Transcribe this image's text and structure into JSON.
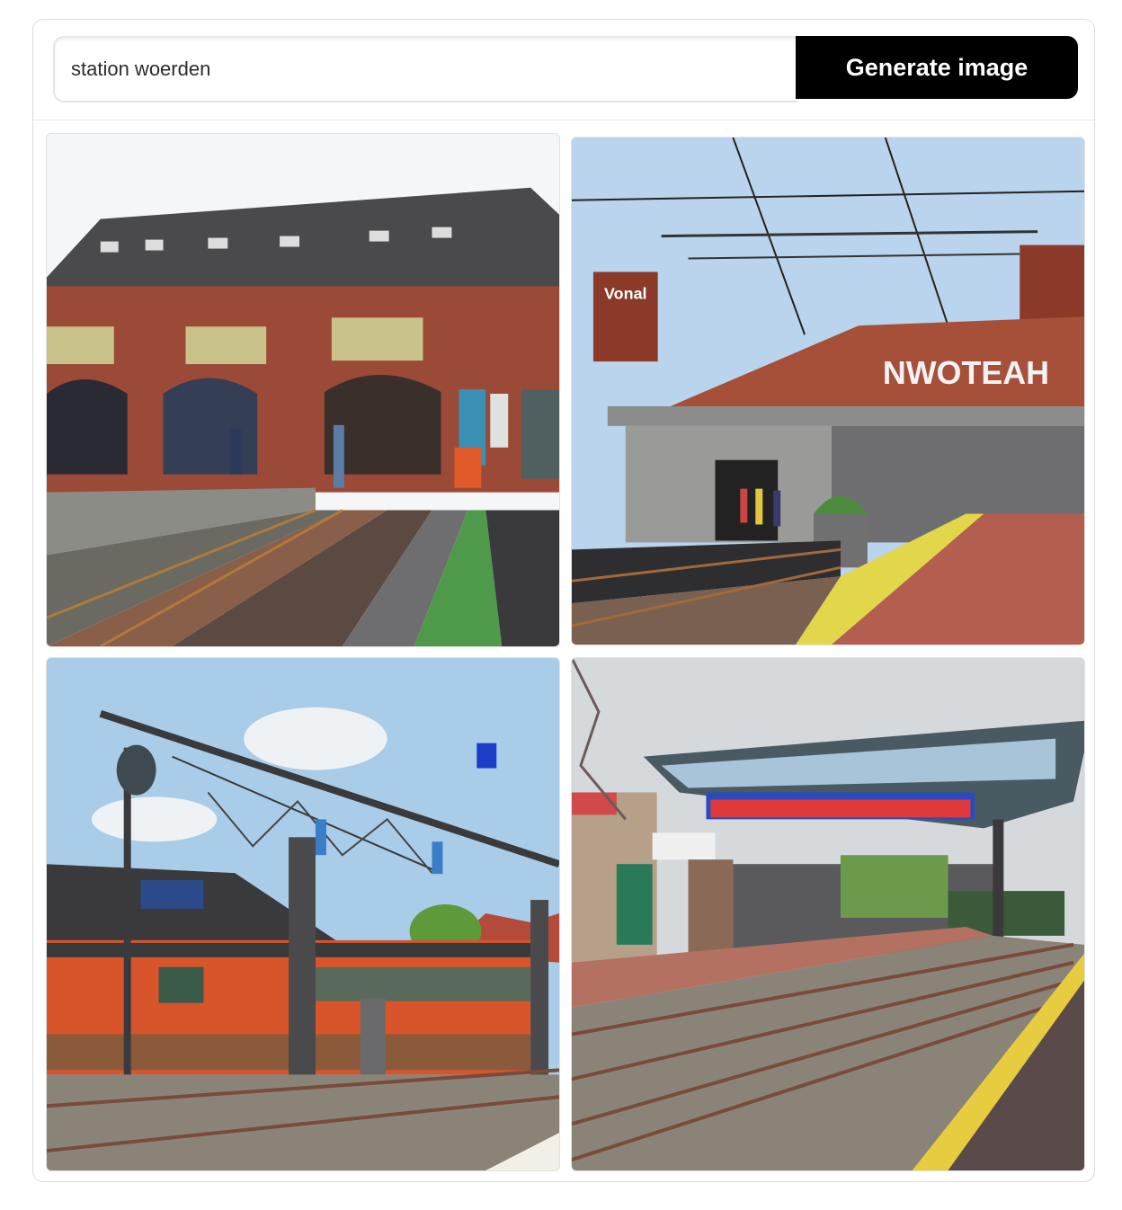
{
  "search": {
    "value": "station woerden",
    "button_label": "Generate image"
  },
  "images": [
    {
      "name": "generated-image-1",
      "sign_text": ""
    },
    {
      "name": "generated-image-2",
      "sign_text": "NWOTEAH",
      "board_text": "Vonal"
    },
    {
      "name": "generated-image-3"
    },
    {
      "name": "generated-image-4"
    }
  ]
}
